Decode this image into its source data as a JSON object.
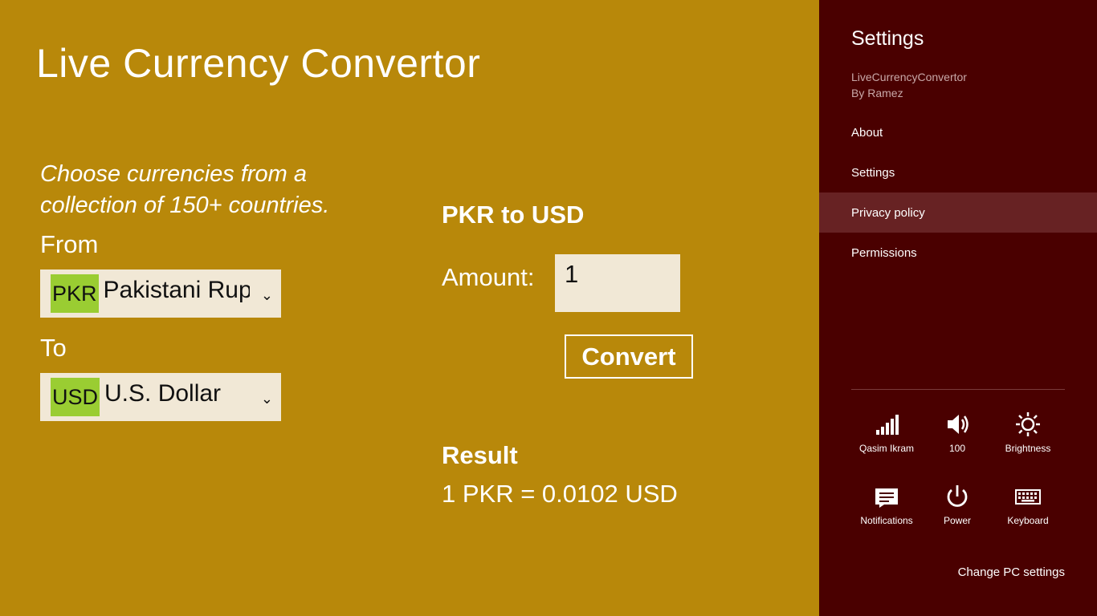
{
  "app": {
    "title": "Live Currency Convertor",
    "tagline": "Choose currencies from a collection of 150+ countries.",
    "from_label": "From",
    "to_label": "To",
    "from": {
      "code": "PKR",
      "name": "Pakistani Rupee"
    },
    "to": {
      "code": "USD",
      "name": "U.S. Dollar"
    },
    "pair_title": "PKR to USD",
    "amount_label": "Amount:",
    "amount_value": "1",
    "convert_label": "Convert",
    "result_title": "Result",
    "result_value": "1 PKR = 0.0102 USD",
    "colors": {
      "background": "#b8880a",
      "code_highlight": "#9acd32",
      "field_bg": "#f1e8d6"
    }
  },
  "settings_pane": {
    "title": "Settings",
    "app_name": "LiveCurrencyConvertor",
    "author": "By Ramez",
    "items": [
      {
        "label": "About"
      },
      {
        "label": "Settings"
      },
      {
        "label": "Privacy policy"
      },
      {
        "label": "Permissions"
      }
    ],
    "tiles": [
      {
        "label": "Qasim Ikram",
        "icon": "network-signal-icon"
      },
      {
        "label": "100",
        "icon": "volume-icon"
      },
      {
        "label": "Brightness",
        "icon": "brightness-icon"
      },
      {
        "label": "Notifications",
        "icon": "notifications-icon"
      },
      {
        "label": "Power",
        "icon": "power-icon"
      },
      {
        "label": "Keyboard",
        "icon": "keyboard-icon"
      }
    ],
    "change_pc_settings": "Change PC settings",
    "colors": {
      "background": "#4a0000",
      "active_item": "#672223"
    }
  }
}
